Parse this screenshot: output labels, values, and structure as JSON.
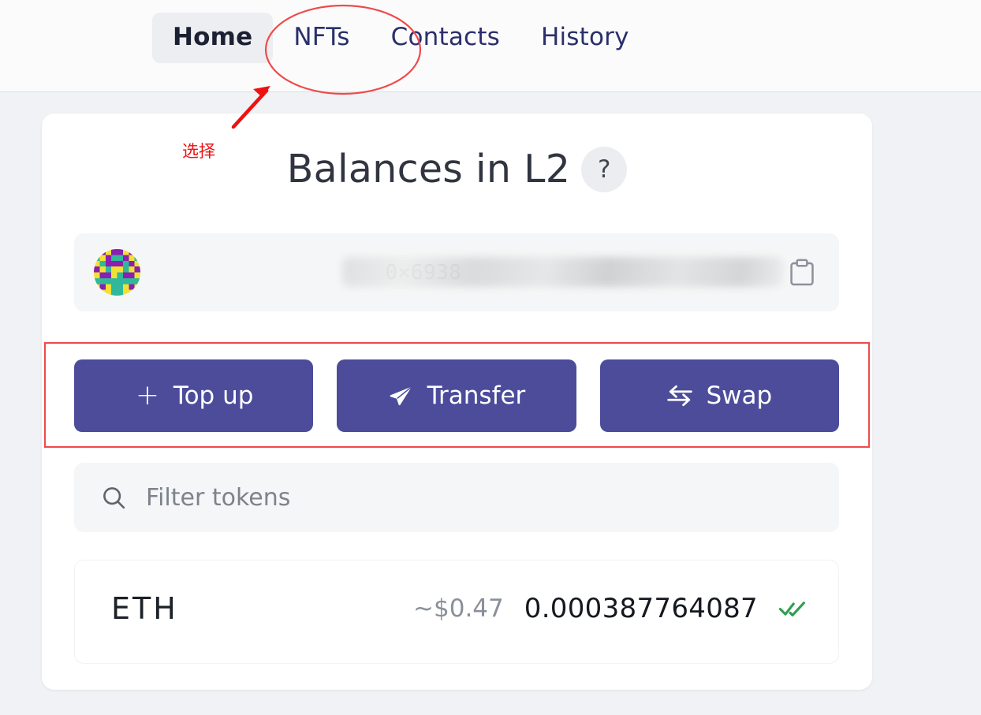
{
  "nav": {
    "tabs": [
      {
        "label": "Home",
        "active": true
      },
      {
        "label": "NFTs",
        "active": false
      },
      {
        "label": "Contacts",
        "active": false
      },
      {
        "label": "History",
        "active": false
      }
    ]
  },
  "card": {
    "title": "Balances in L2",
    "help_badge": "?",
    "account": {
      "address": "0×6938",
      "address_redacted": true,
      "avatar_icon": "identicon-avatar",
      "copy_icon": "clipboard-copy-icon"
    },
    "actions": [
      {
        "label": "Top up",
        "icon": "plus-icon",
        "glyph": "+"
      },
      {
        "label": "Transfer",
        "icon": "send-paper-plane-icon"
      },
      {
        "label": "Swap",
        "icon": "swap-arrows-icon"
      }
    ],
    "filter": {
      "placeholder": "Filter tokens",
      "value": "",
      "icon": "search-icon"
    },
    "tokens": [
      {
        "symbol": "ETH",
        "usd_value": "~$0.47",
        "amount": "0.000387764087",
        "status_icon": "double-check-verified-icon"
      }
    ]
  },
  "annotations": {
    "label_text": "选择",
    "ellipse_target": "NFTs",
    "arrow_color": "#ee1111",
    "ellipse_color": "#ef4a4a",
    "rect_color": "#ef4a4a"
  },
  "colors": {
    "accent_button": "#4c4c9b",
    "page_background": "#f0f2f5",
    "card_background": "#ffffff",
    "nav_background": "#fbfbfc",
    "verified_green": "#2f9e50",
    "annotation_red": "#ee1111"
  }
}
